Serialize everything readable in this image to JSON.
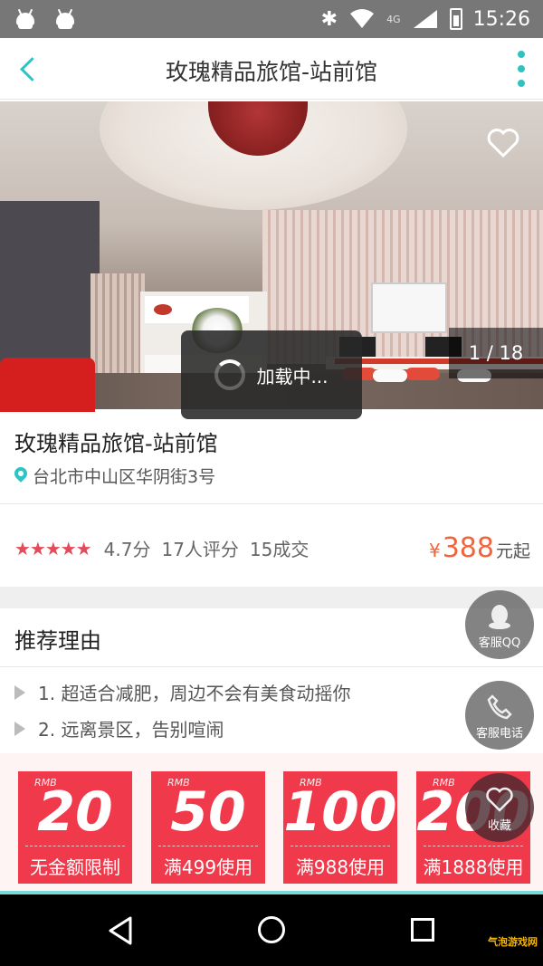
{
  "status_bar": {
    "time": "15:26",
    "network": "4G"
  },
  "header": {
    "title": "玫瑰精品旅馆-站前馆"
  },
  "gallery": {
    "counter": "1 / 18"
  },
  "loading": {
    "text": "加载中..."
  },
  "hotel": {
    "name": "玫瑰精品旅馆-站前馆",
    "address": "台北市中山区华阴街3号",
    "stars": "★★★★★",
    "score": "4.7分",
    "reviews": "17人评分",
    "deals": "15成交",
    "price_currency": "¥",
    "price": "388",
    "price_suffix": "元起"
  },
  "recommend": {
    "title": "推荐理由",
    "items": [
      "1. 超适合减肥，周边不会有美食动摇你",
      "2. 远离景区，告别喧闹"
    ]
  },
  "coupons": [
    {
      "currency": "RMB",
      "amount": "20",
      "condition": "无金额限制"
    },
    {
      "currency": "RMB",
      "amount": "50",
      "condition": "满499使用"
    },
    {
      "currency": "RMB",
      "amount": "100",
      "condition": "满988使用"
    },
    {
      "currency": "RMB",
      "amount": "200",
      "condition": "满1888使用"
    }
  ],
  "floating": {
    "qq_label": "客服QQ",
    "phone_label": "客服电话",
    "fav_label": "收藏"
  },
  "watermark": "气泡游戏网",
  "colors": {
    "accent": "#2ec4c4",
    "price": "#f0653d",
    "coupon": "#f03a4b",
    "star": "#e24b5a"
  }
}
